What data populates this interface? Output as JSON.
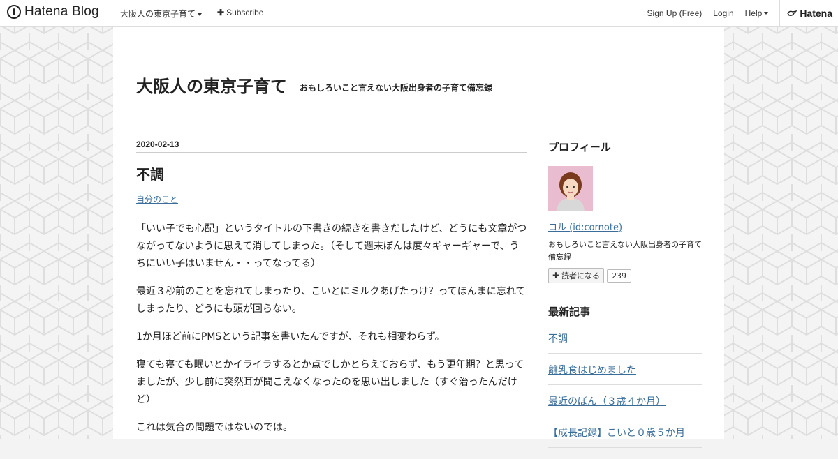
{
  "header": {
    "brand": "Hatena Blog",
    "blog_name": "大阪人の東京子育て",
    "subscribe_label": "Subscribe",
    "signup_label": "Sign Up (Free)",
    "login_label": "Login",
    "help_label": "Help",
    "hatena_label": "Hatena"
  },
  "blog": {
    "title": "大阪人の東京子育て",
    "description": "おもしろいこと言えない大阪出身者の子育て備忘録"
  },
  "entry": {
    "date": "2020-02-13",
    "title": "不調",
    "category": "自分のこと",
    "paragraphs": [
      "「いい子でも心配」というタイトルの下書きの続きを書きだしたけど、どうにも文章がつながってないように思えて消してしまった。（そして週末ぼんは度々ギャーギャーで、うちにいい子はいません・・ってなってる）",
      "最近３秒前のことを忘れてしまったり、こいとにミルクあげたっけ？ってほんまに忘れてしまったり、どうにも頭が回らない。",
      "1か月ほど前にPMSという記事を書いたんですが、それも相変わらず。",
      "寝ても寝ても眠いとかイライラするとか点でしかとらえておらず、もう更年期？と思ってましたが、少し前に突然耳が聞こえなくなったのを思い出しました（すぐ治ったんだけど）",
      "これは気合の問題ではないのでは。"
    ]
  },
  "sidebar": {
    "profile_heading": "プロフィール",
    "profile_name": "コル (id:cornote)",
    "profile_desc": "おもしろいこと言えない大阪出身者の子育て備忘録",
    "subscribe_label": "読者になる",
    "subscriber_count": "239",
    "recent_heading": "最新記事",
    "recent_items": [
      "不調",
      "離乳食はじめました",
      "最近のぼん（３歳４か月）",
      "【成長記録】こいと０歳５か月"
    ]
  },
  "colors": {
    "link": "#3a6d9a",
    "avatar_bg": "#e9bcd0"
  }
}
